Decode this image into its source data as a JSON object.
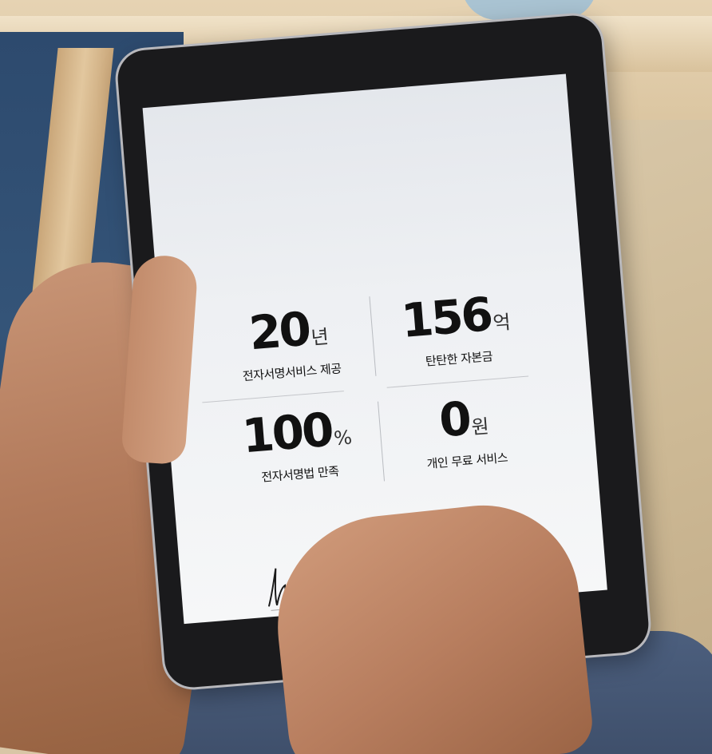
{
  "stats": [
    {
      "number": "20",
      "unit": "년",
      "label": "전자서명서비스 제공"
    },
    {
      "number": "156",
      "unit": "억",
      "label": "탄탄한 자본금"
    },
    {
      "number": "100",
      "unit": "%",
      "label": "전자서명법 만족"
    },
    {
      "number": "0",
      "unit": "원",
      "label": "개인 무료 서비스"
    }
  ]
}
